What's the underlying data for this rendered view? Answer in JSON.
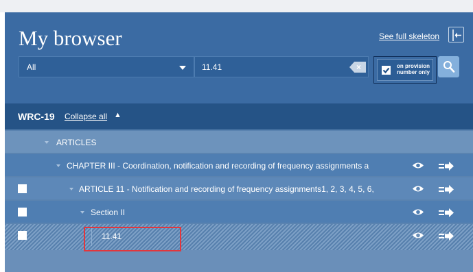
{
  "browser": {
    "title": "My browser",
    "see_full_skeleton": "See full skeleton"
  },
  "filter": {
    "scope_selected": "All",
    "search_value": "11.41",
    "provision_only_label": "on provision number only",
    "provision_only_checked": true
  },
  "tree": {
    "root": "WRC-19",
    "collapse_all": "Collapse all",
    "rows": [
      {
        "label": "ARTICLES",
        "checkbox": false
      },
      {
        "label": "CHAPTER III - Coordination, notification and recording of frequency assignments a",
        "checkbox": false
      },
      {
        "label": "ARTICLE 11 - Notification and recording of frequency assignments1, 2, 3, 4, 5, 6,",
        "checkbox": true
      },
      {
        "label": "Section II",
        "checkbox": true
      },
      {
        "label": "11.41",
        "checkbox": true
      }
    ]
  },
  "colors": {
    "header_bg": "#3b6ba3",
    "tree_bg": "#6a8fb9",
    "highlight": "#e3363c"
  },
  "icons": {
    "eye": "eye-icon",
    "goto": "arrow-right-icon",
    "search": "magnifier-icon",
    "panel": "collapse-panel-icon"
  }
}
